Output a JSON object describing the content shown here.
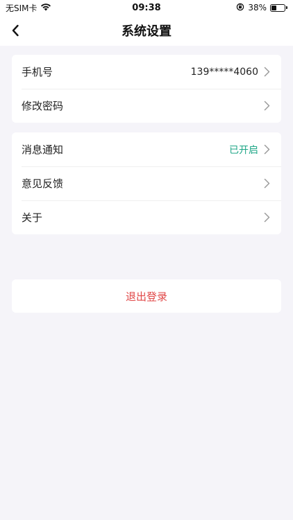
{
  "status_bar": {
    "carrier": "无SIM卡",
    "time": "09:38",
    "battery_percent_text": "38%",
    "battery_level": 0.38
  },
  "nav": {
    "title": "系统设置"
  },
  "group1": [
    {
      "label": "手机号",
      "value": "139*****4060"
    },
    {
      "label": "修改密码",
      "value": ""
    }
  ],
  "group2": [
    {
      "label": "消息通知",
      "value": "已开启"
    },
    {
      "label": "意见反馈",
      "value": ""
    },
    {
      "label": "关于",
      "value": ""
    }
  ],
  "logout": {
    "label": "退出登录"
  },
  "colors": {
    "background": "#f5f4f9",
    "accent_green": "#1ea686",
    "danger_red": "#e14848"
  },
  "icons": [
    "wifi-icon",
    "orientation-lock-icon",
    "battery-icon",
    "back-arrow-icon",
    "chevron-right-icon"
  ]
}
